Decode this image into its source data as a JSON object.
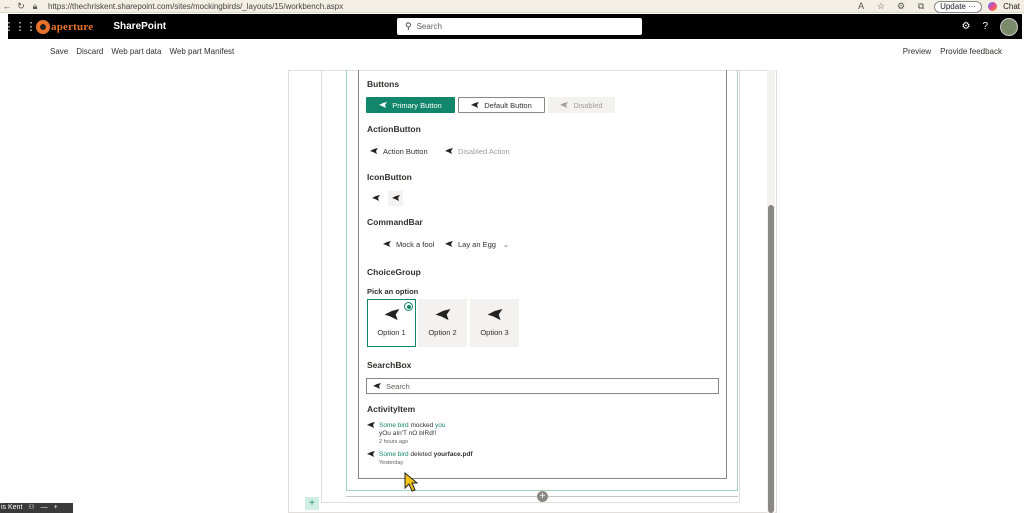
{
  "browser": {
    "url": "https://thechriskent.sharepoint.com/sites/mockingbirds/_layouts/15/workbench.aspx",
    "update_label": "Update",
    "chat_label": "Chat",
    "icons": [
      "back-icon",
      "refresh-icon",
      "lock-icon",
      "read-aloud-icon",
      "favorite-icon",
      "extensions-icon",
      "collections-icon"
    ]
  },
  "suite": {
    "brand": "aperture",
    "title": "SharePoint",
    "search_placeholder": "Search",
    "icons": [
      "waffle-icon",
      "settings-icon",
      "help-icon",
      "avatar"
    ]
  },
  "workbench": {
    "left_commands": [
      "Save",
      "Discard",
      "Web part data",
      "Web part Manifest"
    ],
    "right_commands": [
      "Preview",
      "Provide feedback"
    ]
  },
  "content": {
    "buttons_heading": "Buttons",
    "primary_button": "Primary Button",
    "default_button": "Default Button",
    "disabled_button": "Disabled",
    "action_heading": "ActionButton",
    "action_button": "Action Button",
    "disabled_action": "Disabled Action",
    "iconbutton_heading": "IconButton",
    "commandbar_heading": "CommandBar",
    "command_1": "Mock a fool",
    "command_2": "Lay an Egg",
    "choicegroup_heading": "ChoiceGroup",
    "choice_label": "Pick an option",
    "options": [
      "Option 1",
      "Option 2",
      "Option 3"
    ],
    "selected_option": "Option 1",
    "searchbox_heading": "SearchBox",
    "searchbox_placeholder": "Search",
    "activity_heading": "ActivityItem",
    "activities": [
      {
        "actor": "Some bird",
        "verb": "mocked",
        "target": "you",
        "comment": "yOu aIn'T nO bIRd!!",
        "time": "2 hours ago"
      },
      {
        "actor": "Some bird",
        "verb": "deleted",
        "target": "yourface.pdf",
        "comment": "",
        "time": "Yesterday"
      }
    ]
  },
  "taskbar": {
    "label": "is Kent"
  },
  "colors": {
    "accent": "#12866a",
    "suite_bar": "#000000",
    "brand": "#e8722a"
  }
}
